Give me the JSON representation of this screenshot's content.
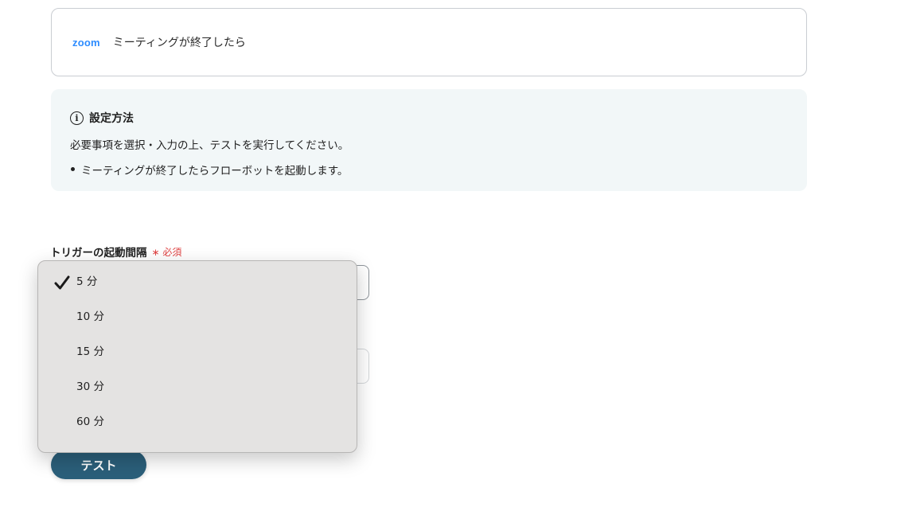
{
  "trigger": {
    "logo_text": "zoom",
    "label": "ミーティングが終了したら"
  },
  "info": {
    "title": "設定方法",
    "description": "必要事項を選択・入力の上、テストを実行してください。",
    "bullets": [
      "ミーティングが終了したらフローボットを起動します。"
    ]
  },
  "field": {
    "label": "トリガーの起動間隔",
    "required_label": "必須"
  },
  "dropdown": {
    "options": [
      "5 分",
      "10 分",
      "15 分",
      "30 分",
      "60 分"
    ],
    "selected": "5 分"
  },
  "actions": {
    "test_label": "テスト"
  },
  "colors": {
    "accent": "#2b5f7a",
    "zoom_blue": "#2d8cff",
    "required_red": "#e04545",
    "info_bg": "#f2f7f8"
  }
}
